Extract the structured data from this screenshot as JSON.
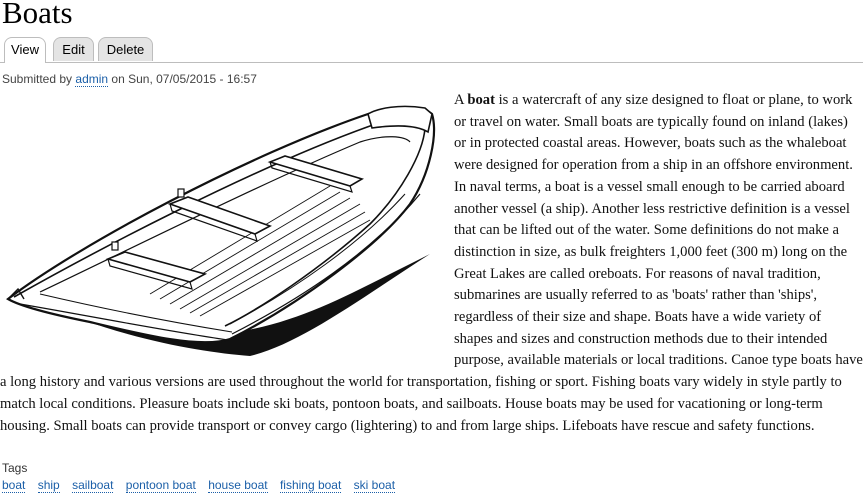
{
  "page": {
    "title": "Boats"
  },
  "tabs": [
    {
      "label": "View",
      "active": true
    },
    {
      "label": "Edit",
      "active": false
    },
    {
      "label": "Delete",
      "active": false
    }
  ],
  "submitted": {
    "prefix": "Submitted by",
    "author": "admin",
    "date_text": "on Sun, 07/05/2015 - 16:57"
  },
  "body": {
    "lead_article": "A",
    "lead_word": "boat",
    "text": "is a watercraft of any size designed to float or plane, to work or travel on water. Small boats are typically found on inland (lakes) or in protected coastal areas. However, boats such as the whaleboat were designed for operation from a ship in an offshore environment. In naval terms, a boat is a vessel small enough to be carried aboard another vessel (a ship).  Another less restrictive definition is a vessel that can be lifted out of the water. Some definitions do not make a distinction in size, as bulk freighters 1,000 feet (300 m) long on the Great Lakes are called oreboats. For reasons of naval tradition, submarines are usually referred to as 'boats' rather than 'ships', regardless of their size and shape. Boats have a wide variety of shapes and sizes and construction methods due to their intended purpose, available materials or local traditions. Canoe type boats have a long history and various versions are used throughout the world for transportation, fishing or sport. Fishing boats vary widely in style partly to match local conditions. Pleasure boats include ski boats, pontoon boats, and sailboats. House boats may be used for vacationing or long-term housing. Small boats can provide transport or convey cargo (lightering) to and from large ships. Lifeboats have rescue and safety functions."
  },
  "tags": {
    "label": "Tags",
    "items": [
      "boat",
      "ship",
      "sailboat",
      "pontoon boat",
      "house boat",
      "fishing boat",
      "ski boat"
    ]
  },
  "colors": {
    "link": "#1b5fa8",
    "tab_inactive": "#e4e4e4",
    "tab_border": "#bdbdbd"
  }
}
